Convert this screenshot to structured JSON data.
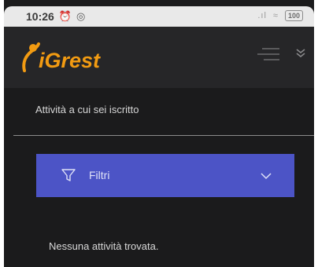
{
  "status": {
    "time": "10:26",
    "battery": "100",
    "icons": [
      "alarm-icon",
      "whatsapp-icon",
      "signal-icon",
      "wifi-icon"
    ]
  },
  "header": {
    "logo_text": "iGrest",
    "menu_icon": "hamburger-icon",
    "dropdown_icon": "chevron-down-icon"
  },
  "card": {
    "title": "Attività a cui sei iscritto",
    "filter": {
      "label": "Filtri",
      "icon": "filter-icon"
    },
    "empty_message": "Nessuna attività trovata."
  },
  "colors": {
    "accent": "#4c54c6",
    "brand": "#f29b12",
    "background": "#1b1b1c",
    "header": "#262628"
  }
}
